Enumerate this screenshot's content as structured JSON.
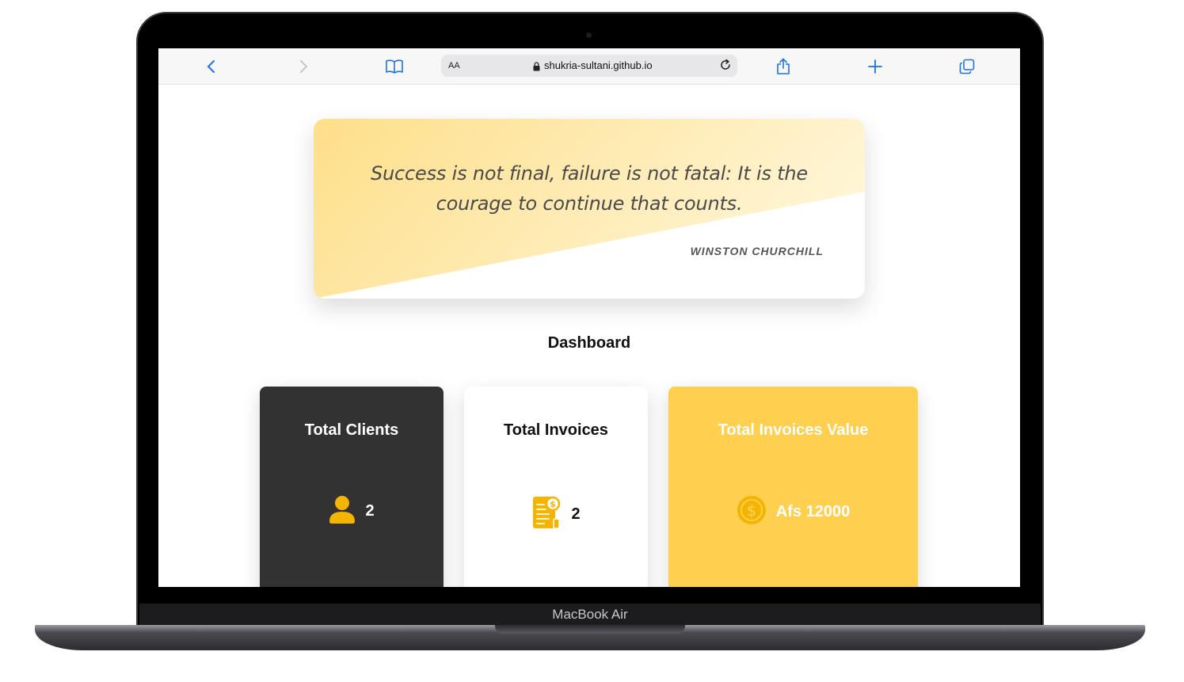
{
  "device": {
    "label": "MacBook Air"
  },
  "browser": {
    "url": "shukria-sultani.github.io",
    "text_size_label": "AA",
    "icons": [
      "back-icon",
      "forward-icon",
      "bookmarks-icon",
      "lock-icon",
      "reload-icon",
      "share-icon",
      "new-tab-icon",
      "tabs-icon"
    ]
  },
  "quote": {
    "text": "Success is not final, failure is not fatal: It is the courage to continue that counts.",
    "author": "WINSTON CHURCHILL"
  },
  "dashboard": {
    "title": "Dashboard",
    "cards": [
      {
        "title": "Total Clients",
        "value": "2",
        "icon": "user-icon",
        "bg": "#323232"
      },
      {
        "title": "Total Invoices",
        "value": "2",
        "icon": "invoice-icon",
        "bg": "#ffffff"
      },
      {
        "title": "Total Invoices Value",
        "value": "Afs 12000",
        "icon": "coin-icon",
        "bg": "#ffcf4f"
      }
    ]
  },
  "colors": {
    "accent": "#f5b400",
    "link_blue": "#1a73e8"
  }
}
